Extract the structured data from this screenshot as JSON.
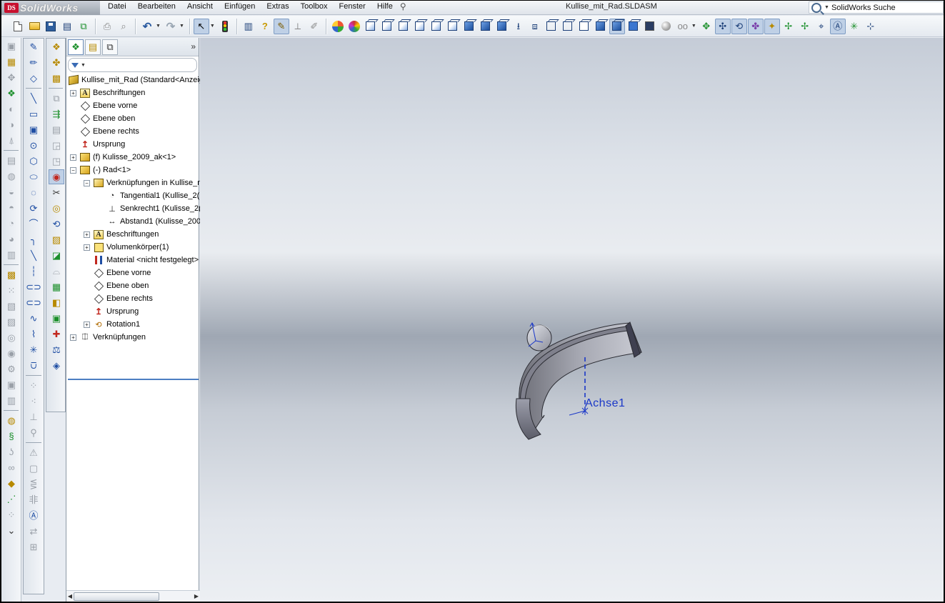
{
  "app": {
    "name": "SolidWorks",
    "document_title": "Kullise_mit_Rad.SLDASM",
    "search_placeholder": "SolidWorks Suche"
  },
  "menu": [
    "Datei",
    "Bearbeiten",
    "Ansicht",
    "Einfügen",
    "Extras",
    "Toolbox",
    "Fenster",
    "Hilfe"
  ],
  "feature_tree": {
    "root": "Kullise_mit_Rad  (Standard<Anzeige",
    "rows": [
      {
        "indent": 0,
        "expander": "+",
        "icon": "annotations-icon",
        "label": "Beschriftungen"
      },
      {
        "indent": 0,
        "expander": "",
        "icon": "plane-icon",
        "label": "Ebene vorne"
      },
      {
        "indent": 0,
        "expander": "",
        "icon": "plane-icon",
        "label": "Ebene oben"
      },
      {
        "indent": 0,
        "expander": "",
        "icon": "plane-icon",
        "label": "Ebene rechts"
      },
      {
        "indent": 0,
        "expander": "",
        "icon": "origin-icon",
        "label": "Ursprung"
      },
      {
        "indent": 0,
        "expander": "+",
        "icon": "part-icon",
        "label": "(f) Kulisse_2009_ak<1>"
      },
      {
        "indent": 0,
        "expander": "-",
        "icon": "part-icon",
        "label": "(-) Rad<1>"
      },
      {
        "indent": 1,
        "expander": "-",
        "icon": "mate-folder-icon",
        "label": "Verknüpfungen in Kullise_m"
      },
      {
        "indent": 2,
        "expander": "",
        "icon": "tangent-mate-icon",
        "label": "Tangential1 (Kullise_2("
      },
      {
        "indent": 2,
        "expander": "",
        "icon": "perpendicular-mate-icon",
        "label": "Senkrecht1 (Kulisse_2("
      },
      {
        "indent": 2,
        "expander": "",
        "icon": "distance-mate-icon",
        "label": "Abstand1 (Kulisse_200"
      },
      {
        "indent": 1,
        "expander": "+",
        "icon": "annotations-icon",
        "label": "Beschriftungen"
      },
      {
        "indent": 1,
        "expander": "+",
        "icon": "solid-bodies-icon",
        "label": "Volumenkörper(1)"
      },
      {
        "indent": 1,
        "expander": "",
        "icon": "material-icon",
        "label": "Material <nicht festgelegt>"
      },
      {
        "indent": 1,
        "expander": "",
        "icon": "plane-icon",
        "label": "Ebene vorne"
      },
      {
        "indent": 1,
        "expander": "",
        "icon": "plane-icon",
        "label": "Ebene oben"
      },
      {
        "indent": 1,
        "expander": "",
        "icon": "plane-icon",
        "label": "Ebene rechts"
      },
      {
        "indent": 1,
        "expander": "",
        "icon": "origin-icon",
        "label": "Ursprung"
      },
      {
        "indent": 1,
        "expander": "+",
        "icon": "revolve-icon",
        "label": "Rotation1"
      },
      {
        "indent": 0,
        "expander": "+",
        "icon": "mates-icon",
        "label": "Verknüpfungen"
      }
    ]
  },
  "viewport": {
    "axis_label": "Achse1"
  }
}
